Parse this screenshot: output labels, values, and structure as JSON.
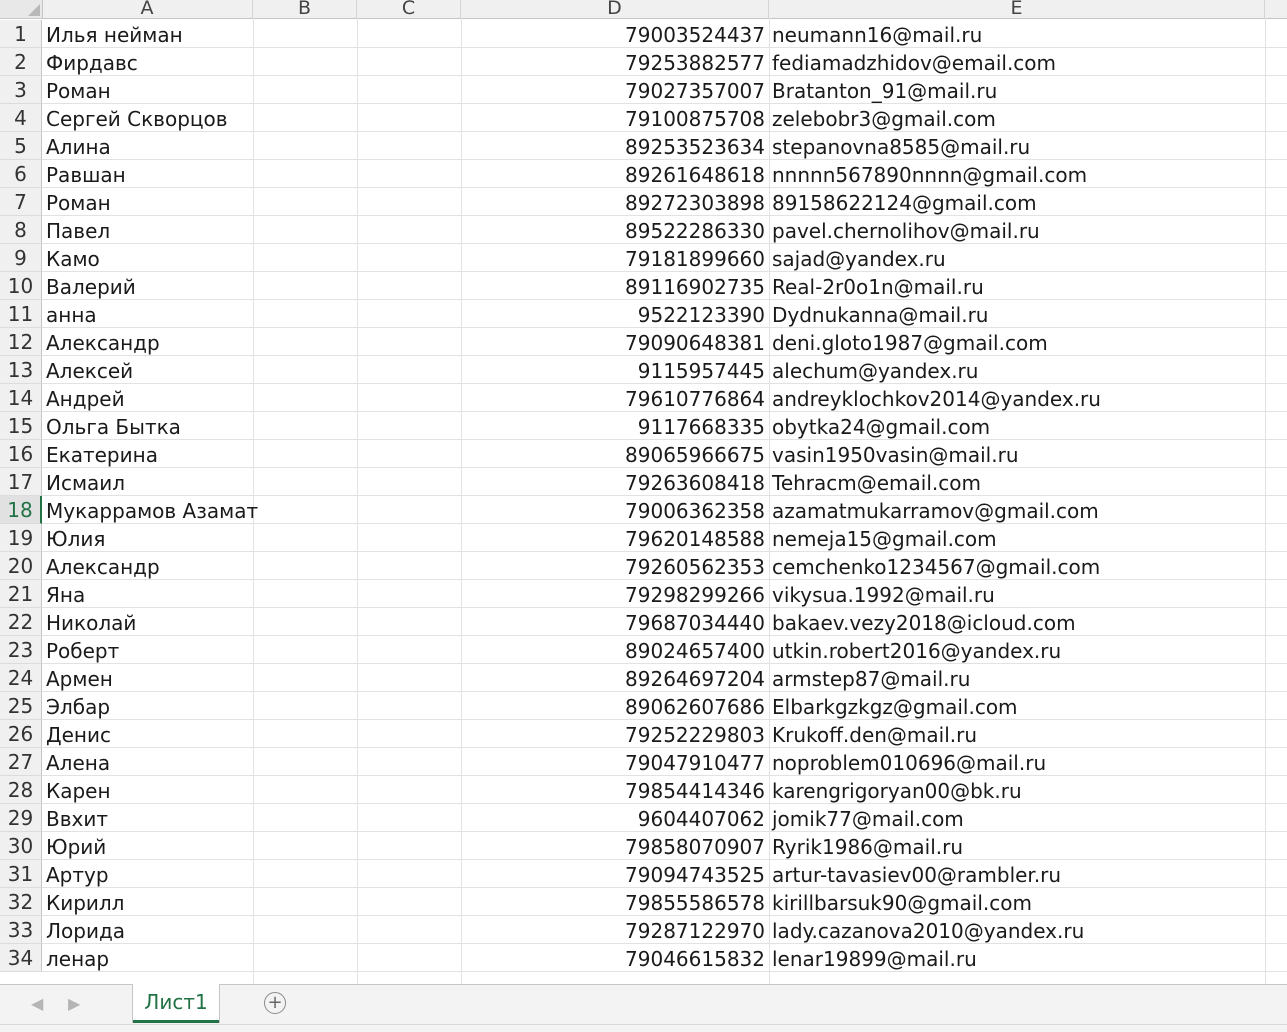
{
  "columns": [
    "A",
    "B",
    "C",
    "D",
    "E"
  ],
  "active_row": 18,
  "rows": [
    {
      "n": "1",
      "name": "Илья нейман",
      "phone": "79003524437",
      "email": "neumann16@mail.ru"
    },
    {
      "n": "2",
      "name": "Фирдавс",
      "phone": "79253882577",
      "email": "fediamadzhidov@email.com"
    },
    {
      "n": "3",
      "name": "Роман",
      "phone": "79027357007",
      "email": "Bratanton_91@mail.ru"
    },
    {
      "n": "4",
      "name": "Сергей Скворцов",
      "phone": "79100875708",
      "email": "zelebobr3@gmail.com"
    },
    {
      "n": "5",
      "name": "Алина",
      "phone": "89253523634",
      "email": "stepanovna8585@mail.ru"
    },
    {
      "n": "6",
      "name": "Равшан",
      "phone": "89261648618",
      "email": "nnnnn567890nnnn@gmail.com"
    },
    {
      "n": "7",
      "name": "Роман",
      "phone": "89272303898",
      "email": "89158622124@gmail.com"
    },
    {
      "n": "8",
      "name": "Павел",
      "phone": "89522286330",
      "email": "pavel.chernolihov@mail.ru"
    },
    {
      "n": "9",
      "name": "Камо",
      "phone": "79181899660",
      "email": "sajad@yandex.ru"
    },
    {
      "n": "10",
      "name": "Валерий",
      "phone": "89116902735",
      "email": "Real-2r0o1n@mail.ru"
    },
    {
      "n": "11",
      "name": "анна",
      "phone": "9522123390",
      "email": "Dydnukanna@mail.ru"
    },
    {
      "n": "12",
      "name": "Александр",
      "phone": "79090648381",
      "email": "deni.gloto1987@gmail.com"
    },
    {
      "n": "13",
      "name": "Алексей",
      "phone": "9115957445",
      "email": "alechum@yandex.ru"
    },
    {
      "n": "14",
      "name": "Андрей",
      "phone": "79610776864",
      "email": "andreyklochkov2014@yandex.ru"
    },
    {
      "n": "15",
      "name": "Ольга Бытка",
      "phone": "9117668335",
      "email": "obytka24@gmail.com"
    },
    {
      "n": "16",
      "name": "Екатерина",
      "phone": "89065966675",
      "email": "vasin1950vasin@mail.ru"
    },
    {
      "n": "17",
      "name": "Исмаил",
      "phone": "79263608418",
      "email": "Tehracm@email.com"
    },
    {
      "n": "18",
      "name": "Мукаррамов Азамат",
      "phone": "79006362358",
      "email": "azamatmukarramov@gmail.com"
    },
    {
      "n": "19",
      "name": "Юлия",
      "phone": "79620148588",
      "email": "nemeja15@gmail.com"
    },
    {
      "n": "20",
      "name": "Александр",
      "phone": "79260562353",
      "email": "cemchenko1234567@gmail.com"
    },
    {
      "n": "21",
      "name": "Яна",
      "phone": "79298299266",
      "email": "vikysua.1992@mail.ru"
    },
    {
      "n": "22",
      "name": "Николай",
      "phone": "79687034440",
      "email": "bakaev.vezy2018@icloud.com"
    },
    {
      "n": "23",
      "name": "Роберт",
      "phone": "89024657400",
      "email": "utkin.robert2016@yandex.ru"
    },
    {
      "n": "24",
      "name": "Армен",
      "phone": "89264697204",
      "email": "armstep87@mail.ru"
    },
    {
      "n": "25",
      "name": "Элбар",
      "phone": "89062607686",
      "email": "Elbarkgzkgz@gmail.com"
    },
    {
      "n": "26",
      "name": "Денис",
      "phone": "79252229803",
      "email": "Krukoff.den@mail.ru"
    },
    {
      "n": "27",
      "name": "Алена",
      "phone": "79047910477",
      "email": "noproblem010696@mail.ru"
    },
    {
      "n": "28",
      "name": "Карен",
      "phone": "79854414346",
      "email": "karengrigoryan00@bk.ru"
    },
    {
      "n": "29",
      "name": "Ввхит",
      "phone": "9604407062",
      "email": "jomik77@mail.com"
    },
    {
      "n": "30",
      "name": "Юрий",
      "phone": "79858070907",
      "email": "Ryrik1986@mail.ru"
    },
    {
      "n": "31",
      "name": "Артур",
      "phone": "79094743525",
      "email": "artur-tavasiev00@rambler.ru"
    },
    {
      "n": "32",
      "name": "Кирилл",
      "phone": "79855586578",
      "email": "kirillbarsuk90@gmail.com"
    },
    {
      "n": "33",
      "name": "Лорида",
      "phone": "79287122970",
      "email": "lady.cazanova2010@yandex.ru"
    },
    {
      "n": "34",
      "name": "ленар",
      "phone": "79046615832",
      "email": "lenar19899@mail.ru"
    }
  ],
  "sheet_tab": "Лист1",
  "icons": {
    "prev": "chevron-left-icon",
    "next": "chevron-right-icon",
    "add": "plus-circle-icon"
  },
  "colors": {
    "accent": "#217346",
    "header_bg": "#f0f0f0",
    "gridline": "#e2e2e2"
  }
}
